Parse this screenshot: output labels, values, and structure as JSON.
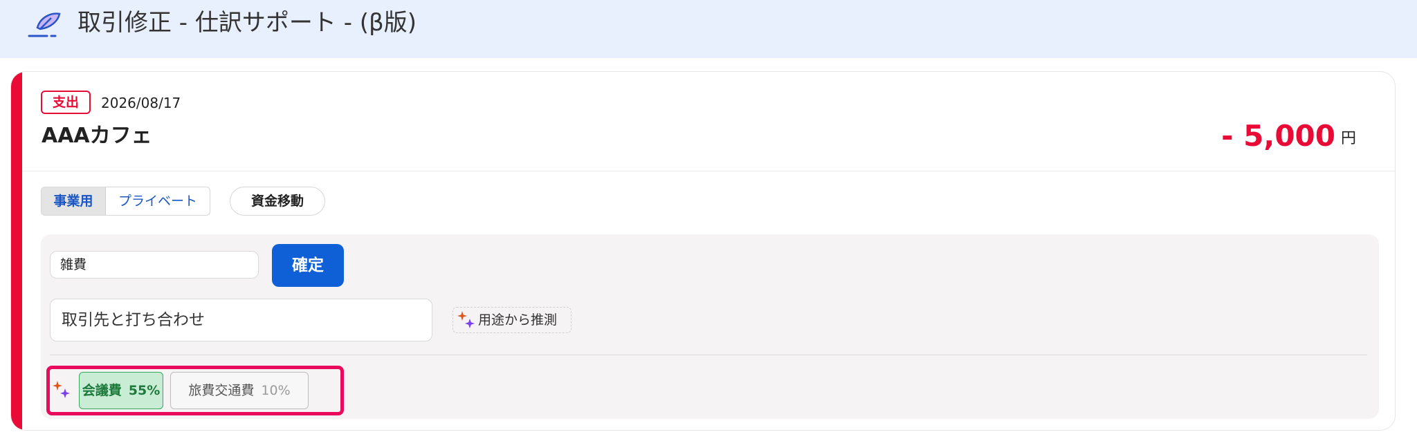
{
  "header": {
    "title": "取引修正 - 仕訳サポート - (β版)",
    "logo_icon": "feather-pen-icon"
  },
  "transaction": {
    "type_badge": "支出",
    "date": "2026/08/17",
    "payee": "AAAカフェ",
    "amount": "- 5,000",
    "currency_unit": "円"
  },
  "usage_toggle": {
    "options": [
      "事業用",
      "プライベート"
    ],
    "selected": "事業用"
  },
  "transfer_button": "資金移動",
  "form": {
    "category_value": "雑費",
    "confirm_label": "確定",
    "memo_value": "取引先と打ち合わせ",
    "guess_label": "用途から推測",
    "guess_icon": "sparkle-icon"
  },
  "suggestions": [
    {
      "label": "会議費",
      "percent": "55%",
      "selected": true
    },
    {
      "label": "旅費交通費",
      "percent": "10%",
      "selected": false
    }
  ],
  "colors": {
    "accent_red": "#ea0a36",
    "primary_blue": "#0f5fd7",
    "header_bg": "#e8f0fd",
    "suggest_green": "#37a85e",
    "highlight_pink": "#ea0a5c"
  }
}
